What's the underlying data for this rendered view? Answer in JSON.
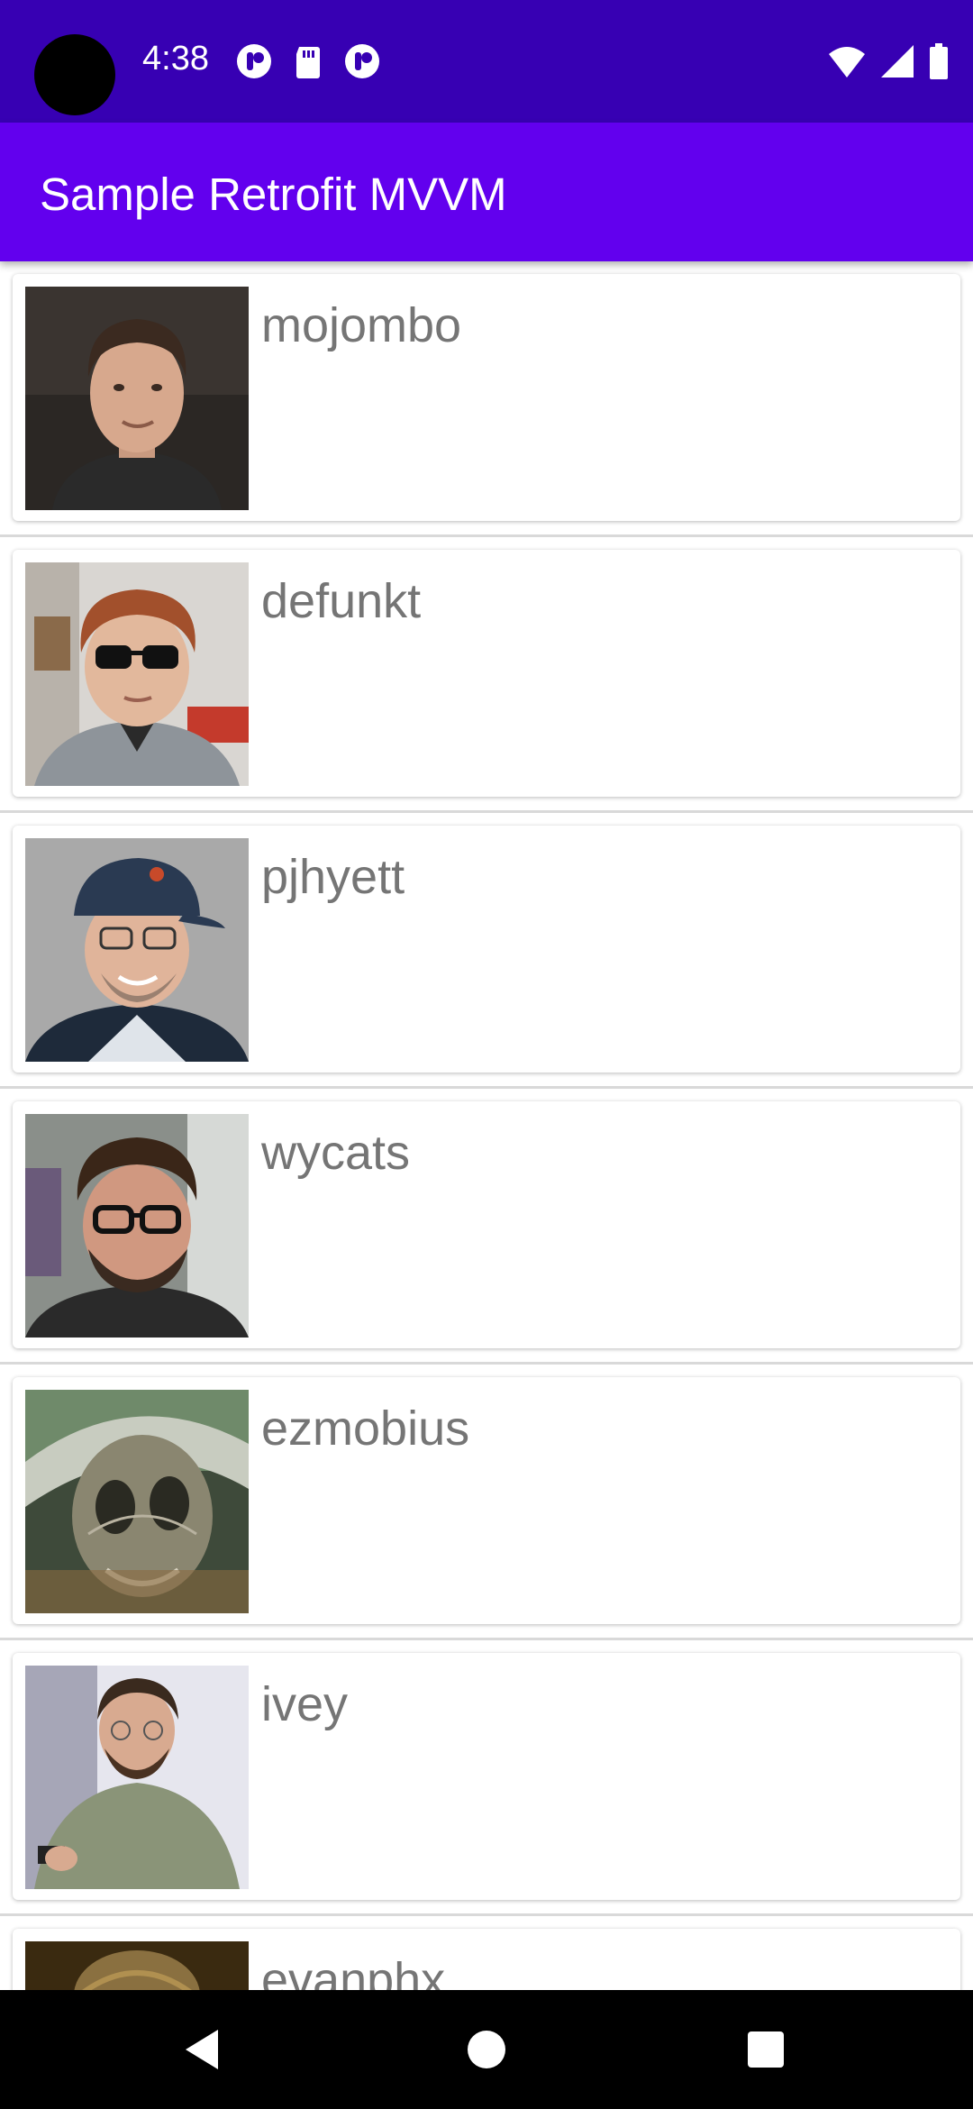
{
  "status_bar": {
    "time": "4:38"
  },
  "app_bar": {
    "title": "Sample Retrofit MVVM"
  },
  "users": [
    {
      "login": "mojombo"
    },
    {
      "login": "defunkt"
    },
    {
      "login": "pjhyett"
    },
    {
      "login": "wycats"
    },
    {
      "login": "ezmobius"
    },
    {
      "login": "ivey"
    },
    {
      "login": "evanphx"
    }
  ],
  "colors": {
    "status_bar": "#3700b3",
    "app_bar": "#6200ee",
    "username_text": "#757575",
    "nav_bar": "#000000"
  }
}
